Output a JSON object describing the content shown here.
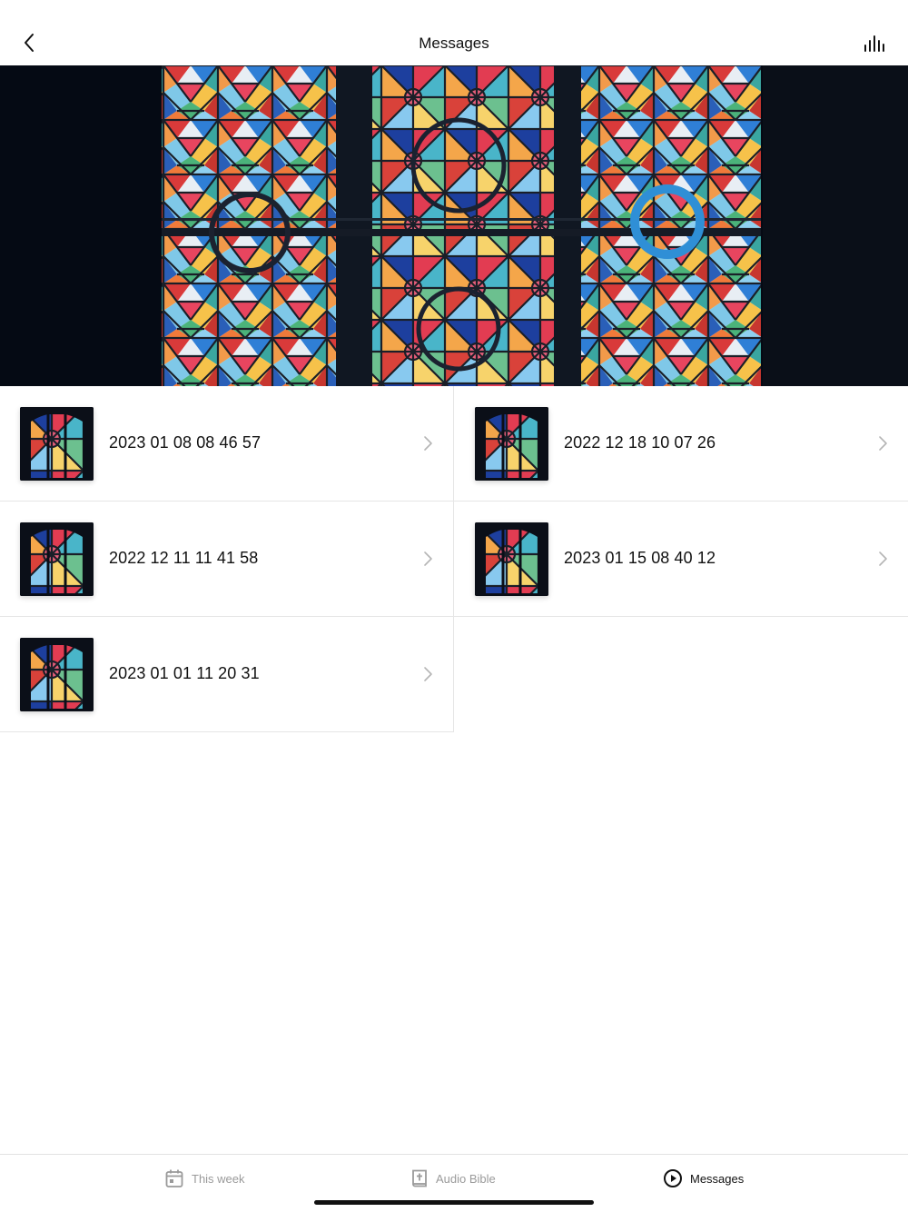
{
  "header": {
    "title": "Messages",
    "back_icon": "chevron-left-icon",
    "action_icon": "audio-waveform-icon"
  },
  "hero": {
    "image": "stained-glass-window-photo"
  },
  "messages": [
    {
      "title": "2023 01 08 08 46 57"
    },
    {
      "title": "2022 12 18 10 07 26"
    },
    {
      "title": "2022 12 11 11 41 58"
    },
    {
      "title": "2023 01 15 08 40 12"
    },
    {
      "title": "2023 01 01 11 20 31"
    }
  ],
  "tabs": [
    {
      "label": "This week",
      "icon": "calendar-icon",
      "active": false
    },
    {
      "label": "Audio Bible",
      "icon": "bible-icon",
      "active": false
    },
    {
      "label": "Messages",
      "icon": "play-circle-icon",
      "active": true
    }
  ],
  "colors": {
    "accent": "#111111",
    "inactive_tab": "#9a9a9a",
    "divider": "#e6e6e6",
    "hero_bg": "#050a14"
  }
}
